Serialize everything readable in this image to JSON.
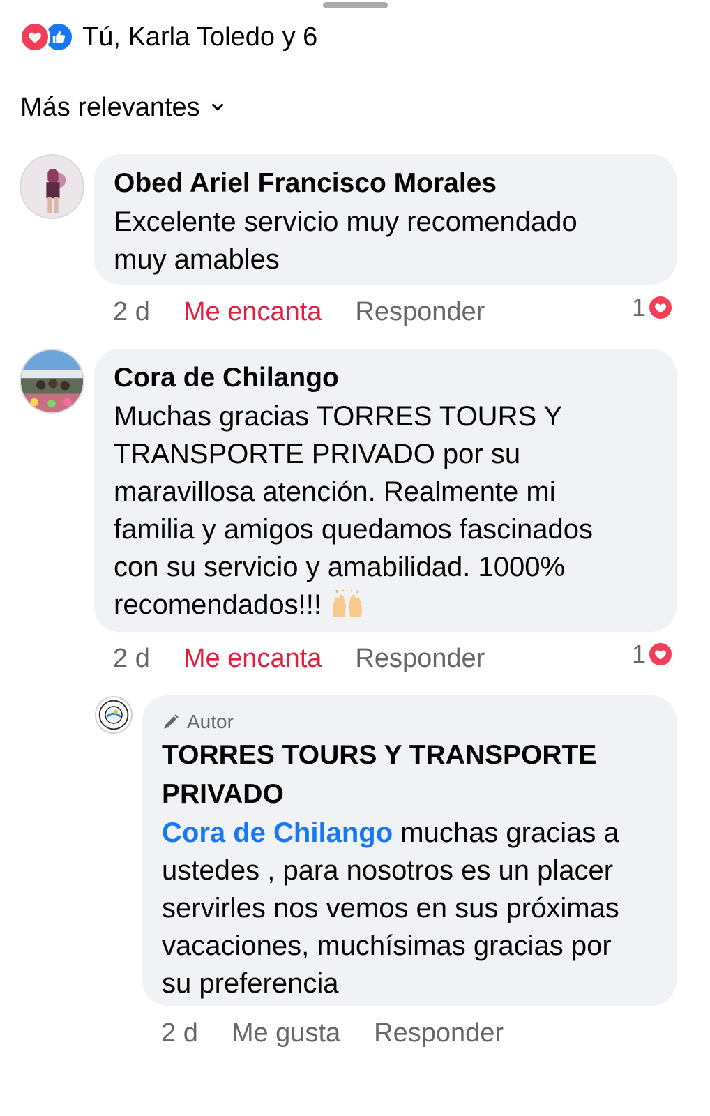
{
  "reactions": {
    "icons": [
      "love-icon",
      "like-icon"
    ],
    "summary": "Tú, Karla Toledo y 6"
  },
  "sort": {
    "label": "Más relevantes",
    "icon": "chevron-down-icon"
  },
  "comments": [
    {
      "author": "Obed Ariel Francisco Morales",
      "lines": [
        "Excelente  servicio  muy recomendado",
        "muy amables"
      ],
      "time": "2 d",
      "reaction_label": "Me encanta",
      "reply_label": "Responder",
      "reaction_count": "1"
    },
    {
      "author": "Cora de Chilango",
      "lines": [
        "Muchas gracias TORRES TOURS Y",
        "TRANSPORTE PRIVADO  por su",
        "maravillosa atención. Realmente mi",
        "familia y amigos quedamos fascinados",
        "con su servicio y amabilidad. 1000%",
        "recomendados!!!"
      ],
      "emoji": "raising-hands-emoji",
      "time": "2 d",
      "reaction_label": "Me encanta",
      "reply_label": "Responder",
      "reaction_count": "1"
    }
  ],
  "reply": {
    "badge": "Autor",
    "author_lines": [
      "TORRES TOURS Y TRANSPORTE",
      "PRIVADO"
    ],
    "mention": "Cora de Chilango",
    "lines": [
      " muchas gracias a",
      "ustedes , para nosotros es un placer",
      "servirles nos vemos en sus próximas",
      "vacaciones, muchísimas gracias por",
      "su preferencia"
    ],
    "time": "2 d",
    "like_label": "Me gusta",
    "reply_label": "Responder"
  },
  "colors": {
    "love": "#f33e58",
    "like": "#1877f2",
    "loved_text": "#e41e3f",
    "bubble": "#f0f2f5",
    "secondary_text": "#65676b"
  }
}
